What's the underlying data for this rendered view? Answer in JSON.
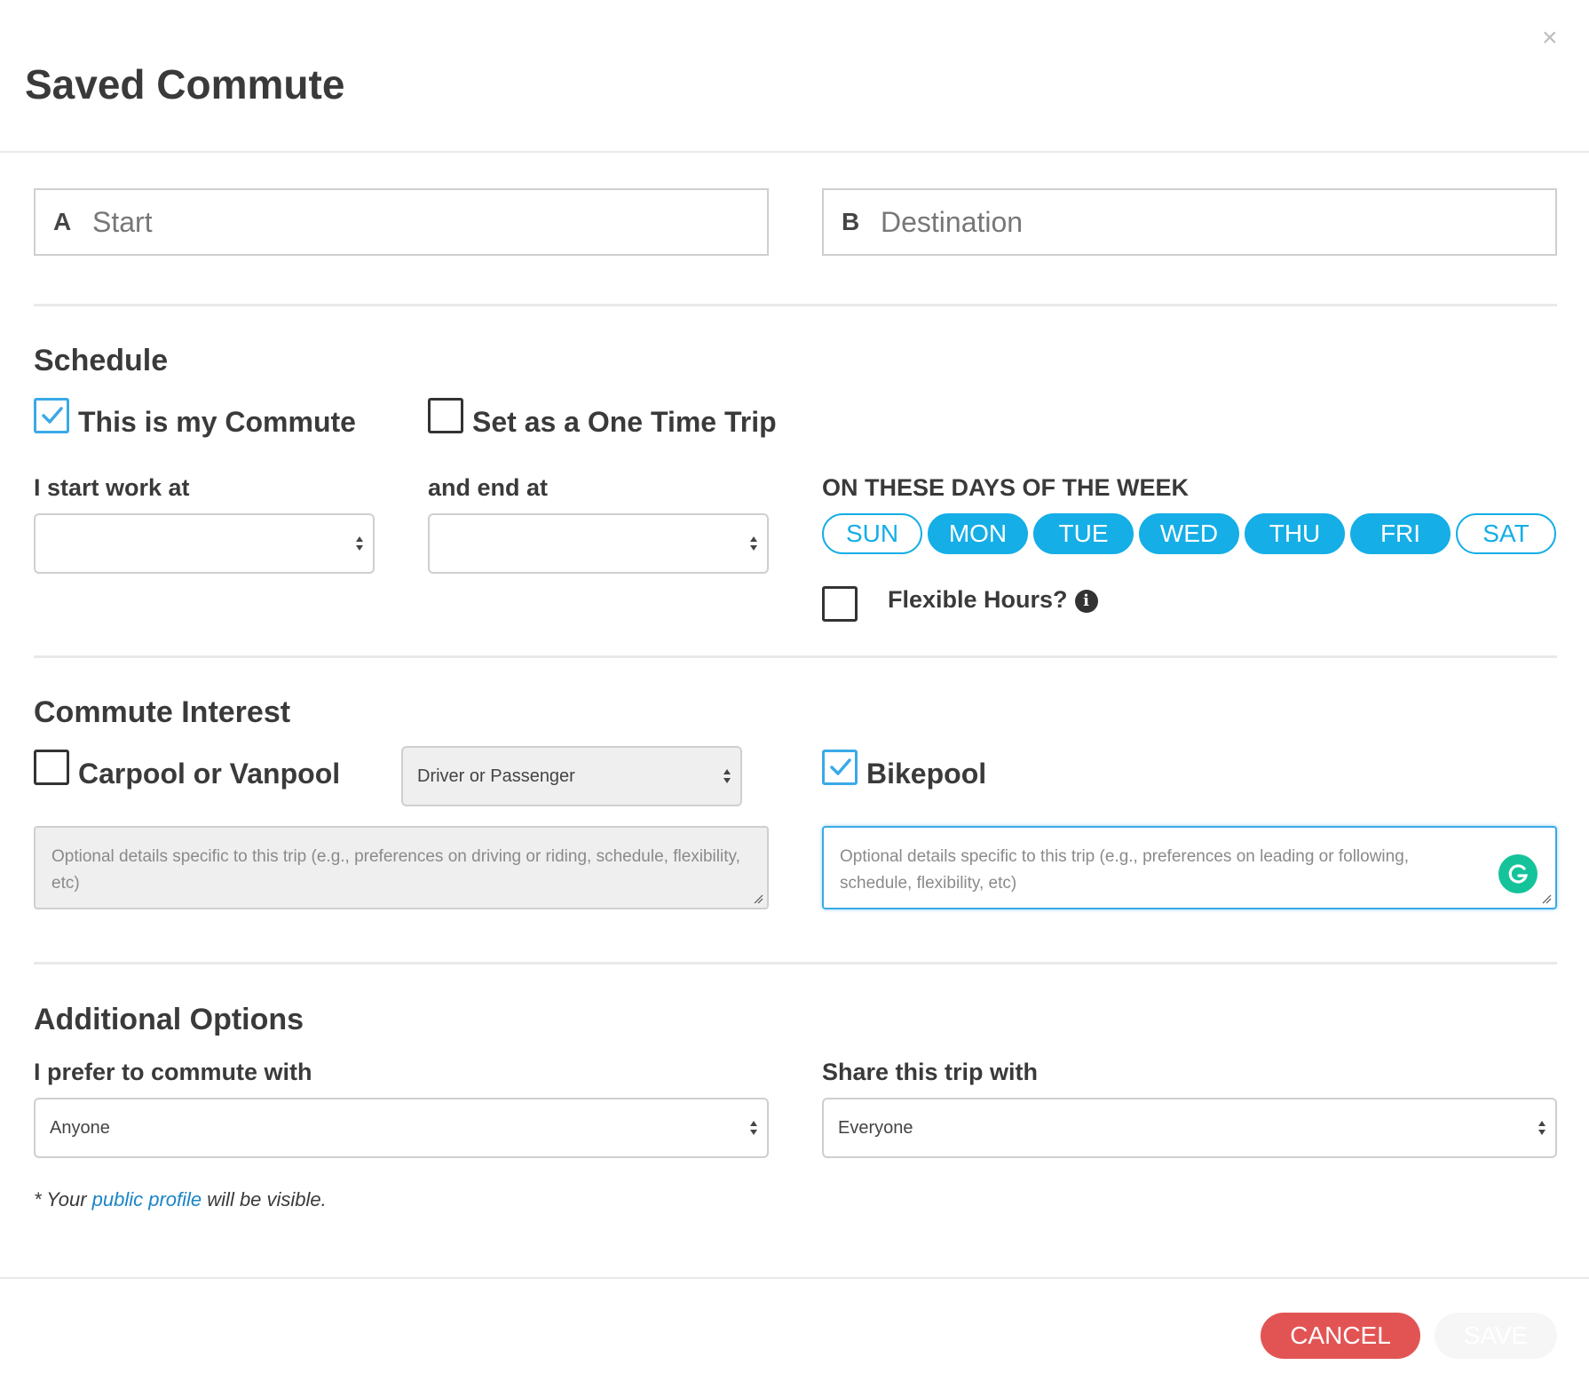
{
  "modal": {
    "title": "Saved Commute",
    "close_glyph": "×"
  },
  "locations": {
    "start": {
      "letter": "A",
      "placeholder": "Start"
    },
    "destination": {
      "letter": "B",
      "placeholder": "Destination"
    }
  },
  "schedule": {
    "title": "Schedule",
    "commute_checkbox": {
      "label": "This is my Commute",
      "checked": true
    },
    "one_time_checkbox": {
      "label": "Set as a One Time Trip",
      "checked": false
    },
    "start_label": "I start work at",
    "start_value": "",
    "end_label": "and end at",
    "end_value": "",
    "days_label": "ON THESE DAYS OF THE WEEK",
    "days": [
      {
        "label": "SUN",
        "selected": false
      },
      {
        "label": "MON",
        "selected": true
      },
      {
        "label": "TUE",
        "selected": true
      },
      {
        "label": "WED",
        "selected": true
      },
      {
        "label": "THU",
        "selected": true
      },
      {
        "label": "FRI",
        "selected": true
      },
      {
        "label": "SAT",
        "selected": false
      }
    ],
    "flexible": {
      "label": "Flexible Hours?",
      "checked": false,
      "icon": "info-icon"
    }
  },
  "commute_interest": {
    "title": "Commute Interest",
    "carpool": {
      "label": "Carpool or Vanpool",
      "checked": false,
      "role_select": "Driver or Passenger",
      "details_placeholder": "Optional details specific to this trip (e.g., preferences on driving or riding, schedule, flexibility, etc)"
    },
    "bikepool": {
      "label": "Bikepool",
      "checked": true,
      "details_placeholder": "Optional details specific to this trip (e.g., preferences on leading or following, schedule, flexibility, etc)"
    }
  },
  "additional": {
    "title": "Additional Options",
    "prefer_label": "I prefer to commute with",
    "prefer_value": "Anyone",
    "share_label": "Share this trip with",
    "share_value": "Everyone",
    "footnote_prefix": "* Your ",
    "footnote_link": "public profile",
    "footnote_suffix": " will be visible."
  },
  "footer": {
    "cancel_label": "CANCEL",
    "save_label": "SAVE"
  },
  "colors": {
    "accent": "#15aee6",
    "cancel": "#e25454",
    "grammarly": "#15c39a"
  }
}
